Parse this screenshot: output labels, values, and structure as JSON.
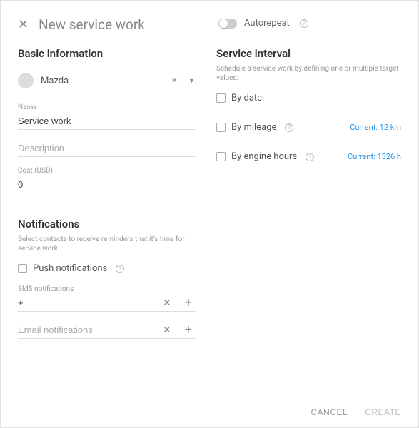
{
  "header": {
    "title": "New service work",
    "autorepeat_label": "Autorepeat"
  },
  "basic": {
    "section_title": "Basic information",
    "vehicle_name": "Mazda",
    "name_label": "Name",
    "name_value": "Service work",
    "description_placeholder": "Description",
    "description_value": "",
    "cost_label": "Cost (USD)",
    "cost_value": "0"
  },
  "notifications": {
    "section_title": "Notifications",
    "subtitle": "Select contacts to receive reminders that it's time for service work",
    "push_label": "Push notifications",
    "sms_label": "SMS notifications",
    "sms_value": "+",
    "email_placeholder": "Email notifications",
    "email_value": ""
  },
  "interval": {
    "section_title": "Service interval",
    "subtitle": "Schedule a service work by defining one or multiple target values:",
    "by_date_label": "By date",
    "by_mileage_label": "By mileage",
    "mileage_current": "Current: 12 km",
    "by_engine_label": "By engine hours",
    "engine_current": "Current: 1326 h"
  },
  "footer": {
    "cancel": "CANCEL",
    "create": "CREATE"
  }
}
